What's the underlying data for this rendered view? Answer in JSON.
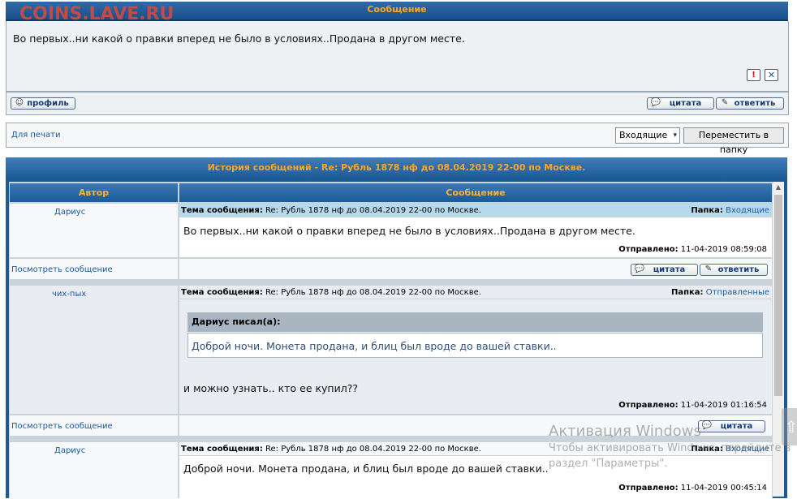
{
  "watermark": "COINS.LAVE.RU",
  "top": {
    "title": "Сообщение",
    "message": "Во первых..ни какой о правки вперед не было в условиях..Продана в другом месте.",
    "profile_label": "профиль",
    "quote_label": "цитата",
    "reply_label": "ответить"
  },
  "toolbar": {
    "print_label": "Для печати",
    "folder_select": "Входящие",
    "move_label": "Переместить в папку"
  },
  "history": {
    "title": "История сообщений - Re: Рубль 1878 нф до 08.04.2019 22-00 по Москве.",
    "col_author": "Автор",
    "col_message": "Сообщение",
    "subject_label": "Тема сообщения:",
    "folder_label": "Папка:",
    "sent_label": "Отправлено:",
    "view_label": "Посмотреть сообщение",
    "quote_label": "цитата",
    "reply_label": "ответить",
    "posts": [
      {
        "author": "Дариус",
        "subject": "Re: Рубль 1878 нф до 08.04.2019 22-00 по Москве.",
        "folder": "Входящие",
        "text": "Во первых..ни какой о правки вперед не было в условиях..Продана в другом месте.",
        "sent": "11-04-2019 08:59:08"
      },
      {
        "author": "чих-пых",
        "subject": "Re: Рубль 1878 нф до 08.04.2019 22-00 по Москве.",
        "folder": "Отправленные",
        "quote_author": "Дариус писал(а):",
        "quote_text": "Доброй ночи. Монета продана, и блиц был вроде до вашей ставки..",
        "text": "и можно узнать.. кто ее купил??",
        "sent": "11-04-2019 01:16:54"
      },
      {
        "author": "Дариус",
        "subject": "Re: Рубль 1878 нф до 08.04.2019 22-00 по Москве.",
        "folder": "Входящие",
        "text": "Доброй ночи. Монета продана, и блиц был вроде до вашей ставки..",
        "sent": "11-04-2019 00:45:14"
      }
    ]
  },
  "activation": {
    "title": "Активация Windows",
    "line1": "Чтобы активировать Windows, перейдите в",
    "line2": "раздел \"Параметры\"."
  },
  "colors": {
    "header_bg": "#1d5b96",
    "header_text": "#ffa623",
    "link": "#1b5aa3",
    "subject_row_bg": "#b7d9ec"
  }
}
